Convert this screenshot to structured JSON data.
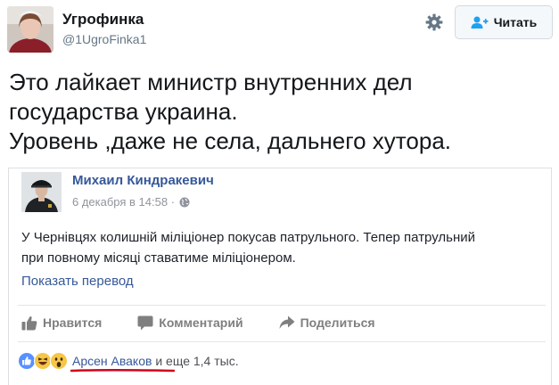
{
  "tweet": {
    "author_name": "Угрофинка",
    "handle": "@1UgroFinka1",
    "follow_label": "Читать",
    "text_lines": [
      "Это лайкает министр внутренних дел",
      "государства украина.",
      "Уровень ,даже не села, дальнего хутора."
    ]
  },
  "fb_post": {
    "author": "Михаил Киндракевич",
    "date": "6 декабря в 14:58 ·",
    "text_lines": [
      "У Чернівцях колишній міліціонер покусав патрульного. Тепер патрульний",
      "при повному місяці ставатиме міліціонером."
    ],
    "translate_link": "Показать перевод",
    "actions": {
      "like": "Нравится",
      "comment": "Комментарий",
      "share": "Поделиться"
    },
    "reactions": {
      "person": "Арсен Аваков",
      "rest": " и еще 1,4 тыс."
    }
  },
  "colors": {
    "fb_link": "#365899",
    "underline": "#d0021b",
    "like_blue": "#5890ff",
    "emoji_yellow": "#f7c646"
  },
  "icons": {
    "gear": "gear-icon",
    "follow": "add-user-icon",
    "globe": "globe-icon",
    "like": "thumbs-up-icon",
    "comment": "comment-icon",
    "share": "share-icon"
  }
}
